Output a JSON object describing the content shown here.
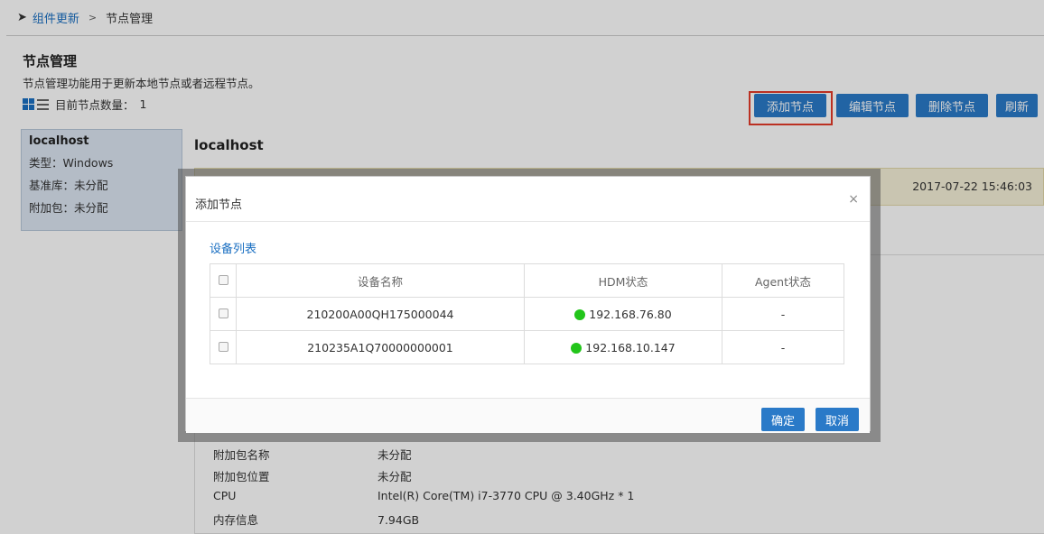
{
  "breadcrumb": {
    "parent": "组件更新",
    "separator": ">",
    "current": "节点管理"
  },
  "page": {
    "title": "节点管理",
    "description": "节点管理功能用于更新本地节点或者远程节点。",
    "count_label": "目前节点数量：",
    "count_value": "1"
  },
  "toolbar": {
    "add": "添加节点",
    "edit": "编辑节点",
    "delete": "删除节点",
    "refresh": "刷新"
  },
  "node_card": {
    "name": "localhost",
    "type": "类型：Windows",
    "baseline": "基准库：未分配",
    "addon": "附加包：未分配"
  },
  "detail": {
    "title": "localhost",
    "date": "2017-07-22 15:46:03",
    "rows": [
      {
        "key": "附加包名称",
        "value": "未分配"
      },
      {
        "key": "附加包位置",
        "value": "未分配"
      },
      {
        "key": "CPU",
        "value": "Intel(R) Core(TM) i7-3770 CPU @ 3.40GHz * 1"
      },
      {
        "key": "内存信息",
        "value": "7.94GB"
      }
    ]
  },
  "modal": {
    "title": "添加节点",
    "close": "×",
    "list_label": "设备列表",
    "columns": [
      "设备名称",
      "HDM状态",
      "Agent状态"
    ],
    "rows": [
      {
        "name": "210200A00QH175000044",
        "hdm": "192.168.76.80",
        "agent": "-"
      },
      {
        "name": "210235A1Q70000000001",
        "hdm": "192.168.10.147",
        "agent": "-"
      }
    ],
    "ok": "确定",
    "cancel": "取消"
  },
  "colors": {
    "accent": "#2a7ac8",
    "highlight": "#e53b2a",
    "status_online": "#22c51a"
  }
}
